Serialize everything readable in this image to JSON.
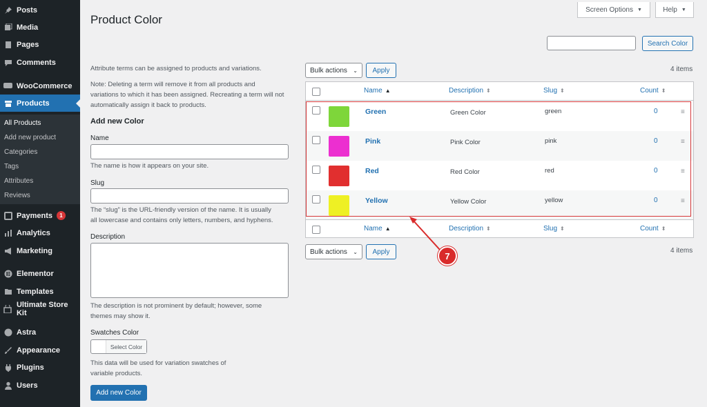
{
  "sidebar": {
    "items_top": [
      {
        "label": "Posts",
        "icon": "pin-icon"
      },
      {
        "label": "Media",
        "icon": "media-icon"
      },
      {
        "label": "Pages",
        "icon": "pages-icon"
      },
      {
        "label": "Comments",
        "icon": "comment-icon"
      },
      {
        "label": "WooCommerce",
        "icon": "woo-icon"
      },
      {
        "label": "Products",
        "icon": "archive-icon"
      }
    ],
    "submenu": [
      "All Products",
      "Add new product",
      "Categories",
      "Tags",
      "Attributes",
      "Reviews"
    ],
    "items_bottom": [
      {
        "label": "Payments",
        "icon": "payments-icon",
        "badge": "1"
      },
      {
        "label": "Analytics",
        "icon": "chart-icon"
      },
      {
        "label": "Marketing",
        "icon": "megaphone-icon"
      },
      {
        "label": "Elementor",
        "icon": "elementor-icon"
      },
      {
        "label": "Templates",
        "icon": "folder-icon"
      },
      {
        "label": "Ultimate Store Kit",
        "icon": "store-icon"
      },
      {
        "label": "Astra",
        "icon": "astra-icon"
      },
      {
        "label": "Appearance",
        "icon": "brush-icon"
      },
      {
        "label": "Plugins",
        "icon": "plugin-icon"
      },
      {
        "label": "Users",
        "icon": "user-icon"
      }
    ]
  },
  "header": {
    "screen_options": "Screen Options",
    "help": "Help",
    "title": "Product Color"
  },
  "search": {
    "button": "Search Color",
    "value": ""
  },
  "form": {
    "intro": "Attribute terms can be assigned to products and variations.",
    "note_lines": [
      "Note: Deleting a term will remove it from all products and",
      "variations to which it has been assigned. Recreating a term will not",
      "automatically assign it back to products."
    ],
    "heading": "Add new Color",
    "name_label": "Name",
    "name_help": "The name is how it appears on your site.",
    "slug_label": "Slug",
    "slug_help_lines": [
      "The “slug” is the URL-friendly version of the name. It is usually",
      "all lowercase and contains only letters, numbers, and hyphens."
    ],
    "description_label": "Description",
    "description_help_lines": [
      "The description is not prominent by default; however, some",
      "themes may show it."
    ],
    "swatches_label": "Swatches Color",
    "select_color": "Select Color",
    "swatches_help_lines": [
      "This data will be used for variation swatches of",
      "variable products."
    ],
    "submit": "Add new Color"
  },
  "table": {
    "bulk_actions": "Bulk actions",
    "apply": "Apply",
    "items_count": "4 items",
    "columns": {
      "name": "Name",
      "description": "Description",
      "slug": "Slug",
      "count": "Count"
    },
    "rows": [
      {
        "name": "Green",
        "description": "Green Color",
        "slug": "green",
        "count": "0",
        "color": "#7ed63a"
      },
      {
        "name": "Pink",
        "description": "Pink Color",
        "slug": "pink",
        "count": "0",
        "color": "#ec2fd0"
      },
      {
        "name": "Red",
        "description": "Red Color",
        "slug": "red",
        "count": "0",
        "color": "#e12f2f"
      },
      {
        "name": "Yellow",
        "description": "Yellow Color",
        "slug": "yellow",
        "count": "0",
        "color": "#eef024"
      }
    ]
  },
  "annotation": {
    "step": "7",
    "color": "#d92b2b"
  }
}
